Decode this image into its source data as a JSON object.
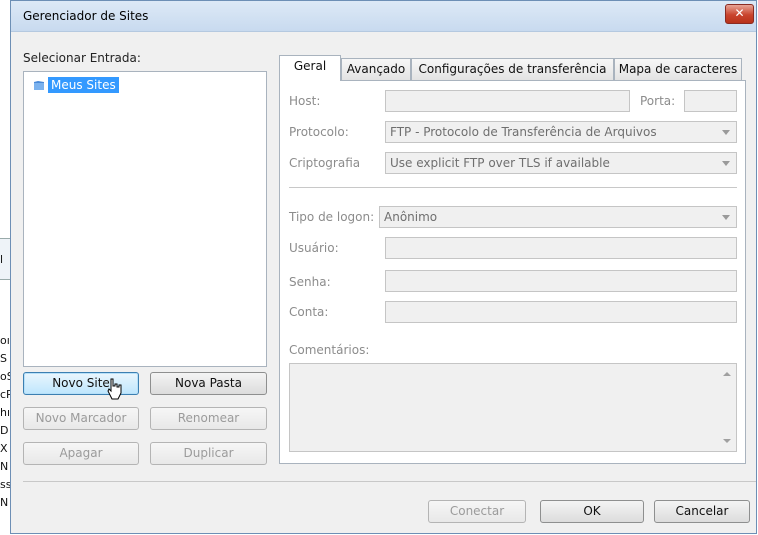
{
  "window": {
    "title": "Gerenciador de Sites",
    "close_label": "✕"
  },
  "background_fragments": [
    "l",
    "oı",
    "S",
    "oS",
    "cP",
    "hı",
    "D",
    "X",
    "N",
    "ss",
    "N"
  ],
  "left": {
    "select_label": "Selecionar Entrada:",
    "tree": [
      {
        "label": "Meus Sites",
        "icon": "folder-icon",
        "selected": true
      }
    ],
    "buttons": {
      "new_site": "Novo Site",
      "new_folder": "Nova Pasta",
      "new_bookmark": "Novo Marcador",
      "rename": "Renomear",
      "delete": "Apagar",
      "duplicate": "Duplicar"
    }
  },
  "tabs": [
    {
      "label": "Geral",
      "active": true
    },
    {
      "label": "Avançado",
      "active": false
    },
    {
      "label": "Configurações de transferência",
      "active": false
    },
    {
      "label": "Mapa de caracteres",
      "active": false
    }
  ],
  "general": {
    "host_label": "Host:",
    "host_value": "",
    "port_label": "Porta:",
    "port_value": "",
    "protocol_label": "Protocolo:",
    "protocol_value": "FTP - Protocolo de Transferência de Arquivos",
    "encryption_label": "Criptografia",
    "encryption_value": "Use explicit FTP over TLS if available",
    "logon_type_label": "Tipo de logon:",
    "logon_type_value": "Anônimo",
    "user_label": "Usuário:",
    "user_value": "",
    "password_label": "Senha:",
    "password_value": "",
    "account_label": "Conta:",
    "account_value": "",
    "comments_label": "Comentários:",
    "comments_value": ""
  },
  "footer": {
    "connect": "Conectar",
    "ok": "OK",
    "cancel": "Cancelar"
  },
  "colors": {
    "selection": "#3399ff",
    "titlebar": "#c8daef",
    "close": "#c9442d"
  }
}
